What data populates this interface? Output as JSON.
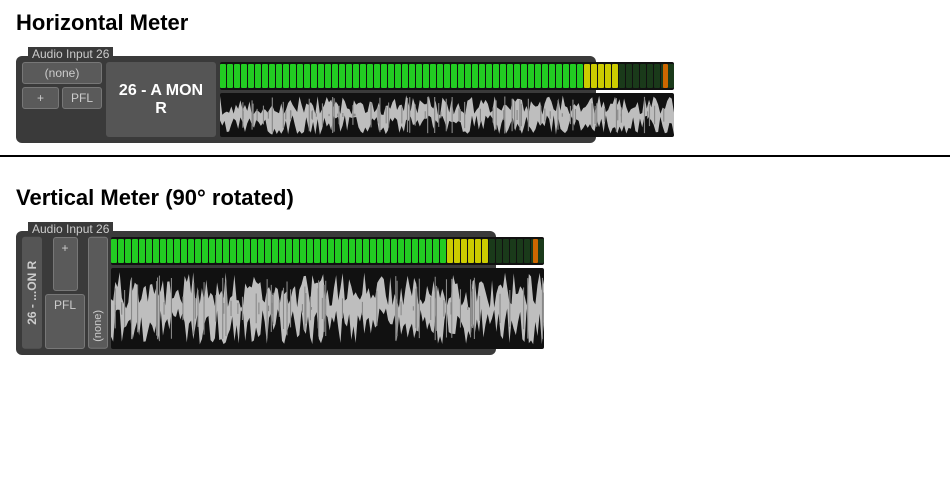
{
  "horizontal": {
    "section_title": "Horizontal Meter",
    "panel_label": "Audio Input 26",
    "none_label": "(none)",
    "plus_label": "+",
    "pfl_label": "PFL",
    "channel_name": "26 - A MON R",
    "vu_green_segs": 52,
    "vu_yellow_segs": 5,
    "vu_dark_segs": 8
  },
  "vertical": {
    "section_title": "Vertical Meter (90° rotated)",
    "panel_label": "Audio Input 26",
    "channel_name": "26 - ...ON R",
    "none_label": "(none)",
    "plus_label": "+",
    "pfl_label": "PFL",
    "vu_green_segs": 48,
    "vu_yellow_segs": 6,
    "vu_dark_segs": 8
  }
}
